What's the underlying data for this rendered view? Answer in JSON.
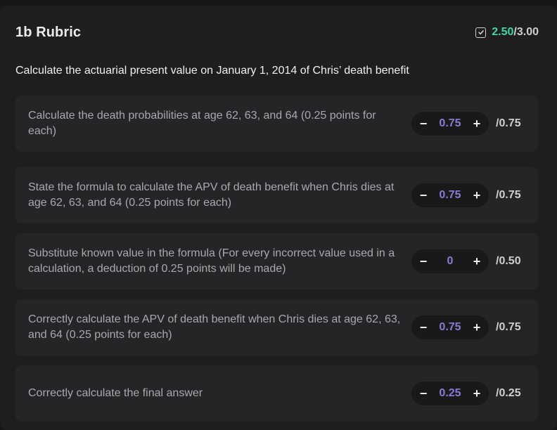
{
  "header": {
    "title": "1b Rubric",
    "score": "2.50",
    "total": "/3.00"
  },
  "question": "Calculate the actuarial present value on January 1, 2014 of Chris’ death benefit",
  "items": [
    {
      "text": "Calculate the death probabilities at age 62, 63, and 64 (0.25 points for each)",
      "score": "0.75",
      "max": "/0.75",
      "minus": "−",
      "plus": "+"
    },
    {
      "text": "State the formula to calculate the APV of death benefit when Chris dies at age 62, 63, and 64 (0.25 points for each)",
      "score": "0.75",
      "max": "/0.75",
      "minus": "−",
      "plus": "+"
    },
    {
      "text": "Substitute known value in the formula (For every incorrect value used in a calculation, a deduction of 0.25 points will be made)",
      "score": "0",
      "max": "/0.50",
      "minus": "−",
      "plus": "+"
    },
    {
      "text": "Correctly calculate the APV of death benefit when Chris dies at age 62, 63, and 64 (0.25 points for each)",
      "score": "0.75",
      "max": "/0.75",
      "minus": "−",
      "plus": "+"
    },
    {
      "text": "Correctly calculate the final answer",
      "score": "0.25",
      "max": "/0.25",
      "minus": "−",
      "plus": "+"
    }
  ],
  "colors": {
    "accent_score": "#3ed6a0",
    "item_score": "#8a7ad6"
  },
  "icons": {
    "score": "checkbox-icon",
    "decrement": "minus-icon",
    "increment": "plus-icon"
  }
}
